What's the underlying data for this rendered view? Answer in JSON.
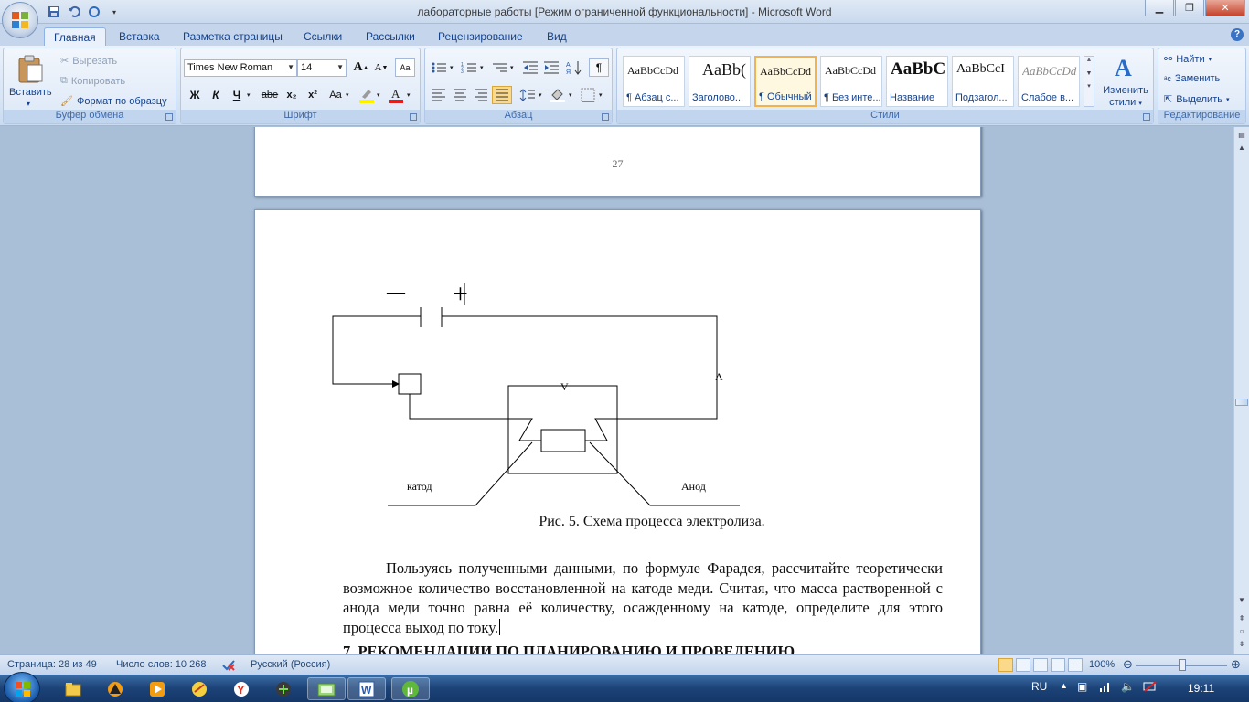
{
  "window": {
    "title": "лабораторные работы [Режим ограниченной функциональности] - Microsoft Word"
  },
  "tabs": [
    {
      "label": "Главная",
      "active": true
    },
    {
      "label": "Вставка"
    },
    {
      "label": "Разметка страницы"
    },
    {
      "label": "Ссылки"
    },
    {
      "label": "Рассылки"
    },
    {
      "label": "Рецензирование"
    },
    {
      "label": "Вид"
    }
  ],
  "ribbon": {
    "clipboard": {
      "paste": "Вставить",
      "cut": "Вырезать",
      "copy": "Копировать",
      "format_painter": "Формат по образцу",
      "group": "Буфер обмена"
    },
    "font": {
      "name": "Times New Roman",
      "size": "14",
      "bold": "Ж",
      "italic": "К",
      "underline": "Ч",
      "strike": "abe",
      "sub": "x₂",
      "sup": "x²",
      "case": "Aa",
      "grow": "A",
      "shrink": "A",
      "group": "Шрифт"
    },
    "paragraph": {
      "group": "Абзац",
      "pilcrow": "¶"
    },
    "styles": {
      "group": "Стили",
      "items": [
        {
          "sample": "AaBbCcDd",
          "name": "¶ Абзац с..."
        },
        {
          "sample": "AaBb(",
          "name": "Заголово..."
        },
        {
          "sample": "AaBbCcDd",
          "name": "¶ Обычный",
          "selected": true
        },
        {
          "sample": "AaBbCcDd",
          "name": "¶ Без инте..."
        },
        {
          "sample": "AaBbC",
          "name": "Название"
        },
        {
          "sample": "AaBbCcI",
          "name": "Подзагол..."
        },
        {
          "sample": "AaBbCcDd",
          "name": "Слабое в..."
        }
      ],
      "change_line1": "Изменить",
      "change_line2": "стили"
    },
    "editing": {
      "group": "Редактирование",
      "find": "Найти",
      "replace": "Заменить",
      "select": "Выделить"
    }
  },
  "document": {
    "page_number": "27",
    "diagram": {
      "minus": "—",
      "plus": "+",
      "voltmeter": "V",
      "ammeter": "A",
      "cathode": "катод",
      "anode": "Анод"
    },
    "caption": "Рис. 5. Схема процесса электролиза.",
    "paragraph": "Пользуясь полученными данными, по формуле Фарадея, рассчитайте теоретически возможное количество восстановленной на катоде меди. Считая, что масса растворенной с анода меди точно равна её количеству, осажденному на катоде, определите для этого процесса выход по току.",
    "heading": "7. РЕКОМЕНДАЦИИ ПО ПЛАНИРОВАНИЮ И ПРОВЕДЕНИЮ"
  },
  "status": {
    "page": "Страница: 28 из 49",
    "words": "Число слов: 10 268",
    "language": "Русский (Россия)",
    "zoom": "100%"
  },
  "taskbar": {
    "lang": "RU",
    "time": "19:11"
  },
  "colors": {
    "ribbon_text": "#15428b",
    "doc_background": "#a9bfd8",
    "taskbar": "#1c4277"
  }
}
